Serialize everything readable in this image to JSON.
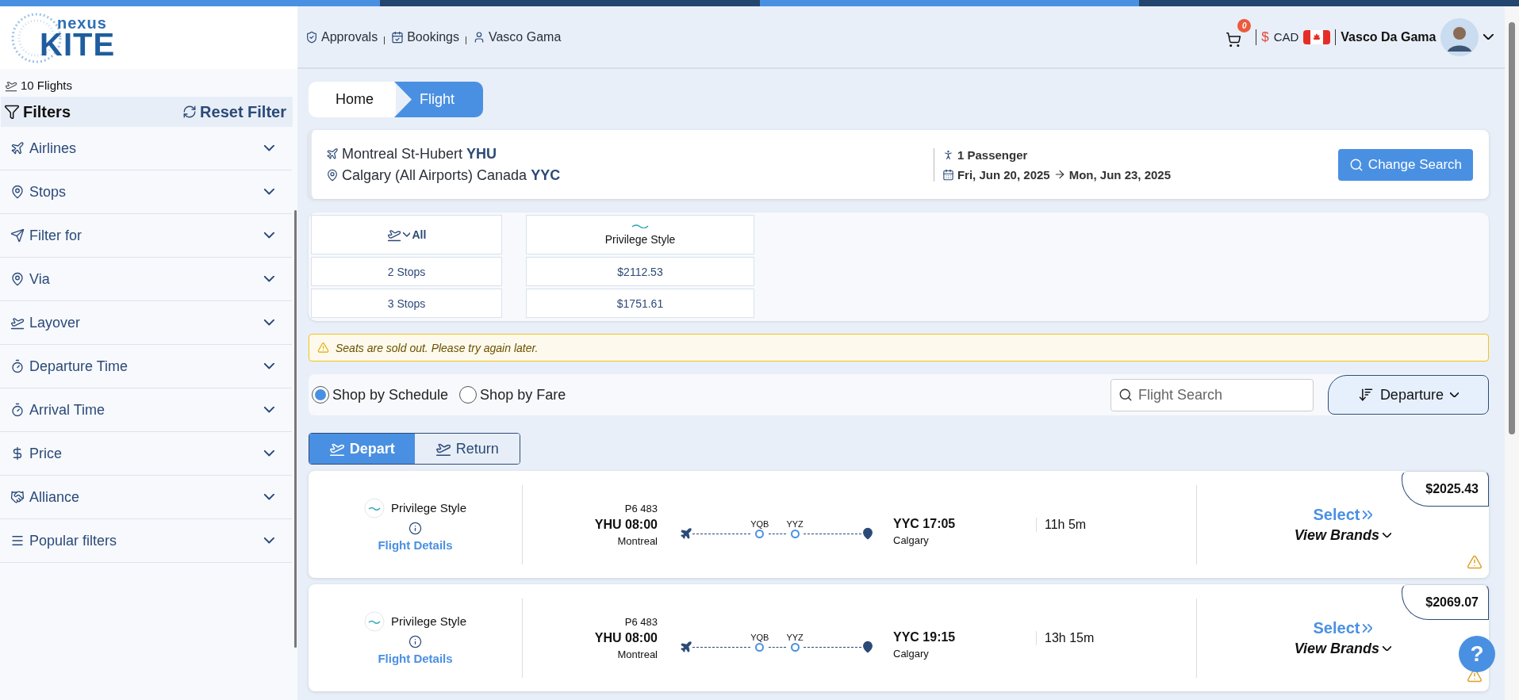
{
  "logo": {
    "small": "nexus",
    "big": "KITE"
  },
  "top_nav": [
    {
      "label": "Approvals"
    },
    {
      "label": "Bookings"
    },
    {
      "label": "Vasco Gama"
    }
  ],
  "header": {
    "cart_count": "0",
    "currency_symbol": "$",
    "currency": "CAD",
    "user_name": "Vasco Da Gama"
  },
  "sidebar": {
    "results": "10 Flights",
    "filters_title": "Filters",
    "reset": "Reset Filter",
    "filters": [
      {
        "label": "Airlines",
        "expanded": false
      },
      {
        "label": "Stops",
        "expanded": false
      },
      {
        "label": "Filter for",
        "expanded": false
      },
      {
        "label": "Via",
        "expanded": false
      },
      {
        "label": "Layover",
        "expanded": false
      },
      {
        "label": "Departure Time",
        "expanded": false
      },
      {
        "label": "Arrival Time",
        "expanded": false
      },
      {
        "label": "Price",
        "expanded": false
      },
      {
        "label": "Alliance",
        "expanded": false
      },
      {
        "label": "Popular filters",
        "expanded": false
      }
    ]
  },
  "breadcrumb": [
    {
      "label": "Home",
      "selected": false
    },
    {
      "label": "Flight",
      "selected": true
    }
  ],
  "search_summary": {
    "origin_city": "Montreal St-Hubert",
    "origin_code": "YHU",
    "destination_city": "Calgary (All Airports) Canada",
    "destination_code": "YYC",
    "passengers": "1 Passenger",
    "depart_date": "Fri, Jun 20, 2025",
    "return_date": "Mon, Jun 23, 2025",
    "button": "Change Search"
  },
  "matrix": {
    "header": "All",
    "rows": [
      "2 Stops",
      "3 Stops"
    ],
    "airlines": [
      {
        "name": "Privilege Style",
        "prices": [
          "$2112.53",
          "$1751.61"
        ]
      }
    ]
  },
  "alert": "Seats are sold out. Please try again later.",
  "shop_modes": [
    {
      "label": "Shop by Schedule",
      "selected": true
    },
    {
      "label": "Shop by Fare",
      "selected": false
    }
  ],
  "flight_search": {
    "placeholder": "Flight Search"
  },
  "sort": {
    "label": "Departure"
  },
  "direction_tabs": [
    {
      "label": "Depart",
      "selected": true
    },
    {
      "label": "Return",
      "selected": false
    }
  ],
  "flights": [
    {
      "airline": "Privilege Style",
      "details_link": "Flight Details",
      "flight_number": "P6 483",
      "departure": "YHU 08:00",
      "departure_city": "Montreal",
      "stops": [
        "YQB",
        "YYZ"
      ],
      "arrival": "YYC 17:05",
      "arrival_city": "Calgary",
      "duration": "11h 5m",
      "price": "$2025.43",
      "select": "Select",
      "brands": "View Brands"
    },
    {
      "airline": "Privilege Style",
      "details_link": "Flight Details",
      "flight_number": "P6 483",
      "departure": "YHU 08:00",
      "departure_city": "Montreal",
      "stops": [
        "YQB",
        "YYZ"
      ],
      "arrival": "YYC 19:15",
      "arrival_city": "Calgary",
      "duration": "13h 15m",
      "price": "$2069.07",
      "select": "Select",
      "brands": "View Brands"
    }
  ],
  "help": "?"
}
